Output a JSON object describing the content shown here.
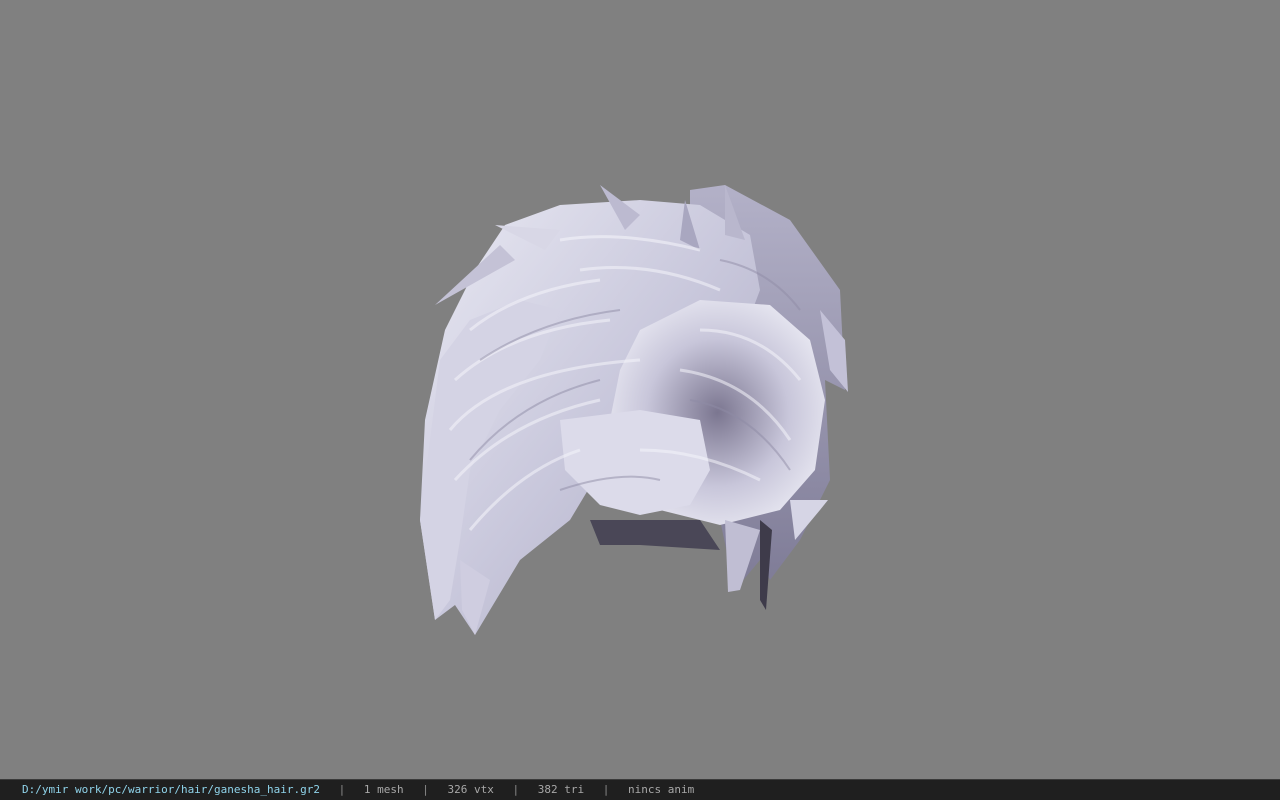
{
  "viewport": {
    "background_color": "#808080",
    "model_icon": "hair-mesh"
  },
  "status_bar": {
    "file_path": "D:/ymir work/pc/warrior/hair/ganesha_hair.gr2",
    "separator": "|",
    "mesh_count": "1 mesh",
    "vertex_count": "326 vtx",
    "triangle_count": "382 tri",
    "anim_status": "nincs anim",
    "path_color": "#8fd3ea",
    "text_color": "#a8a8a8",
    "background_color": "#1f1f1f"
  }
}
